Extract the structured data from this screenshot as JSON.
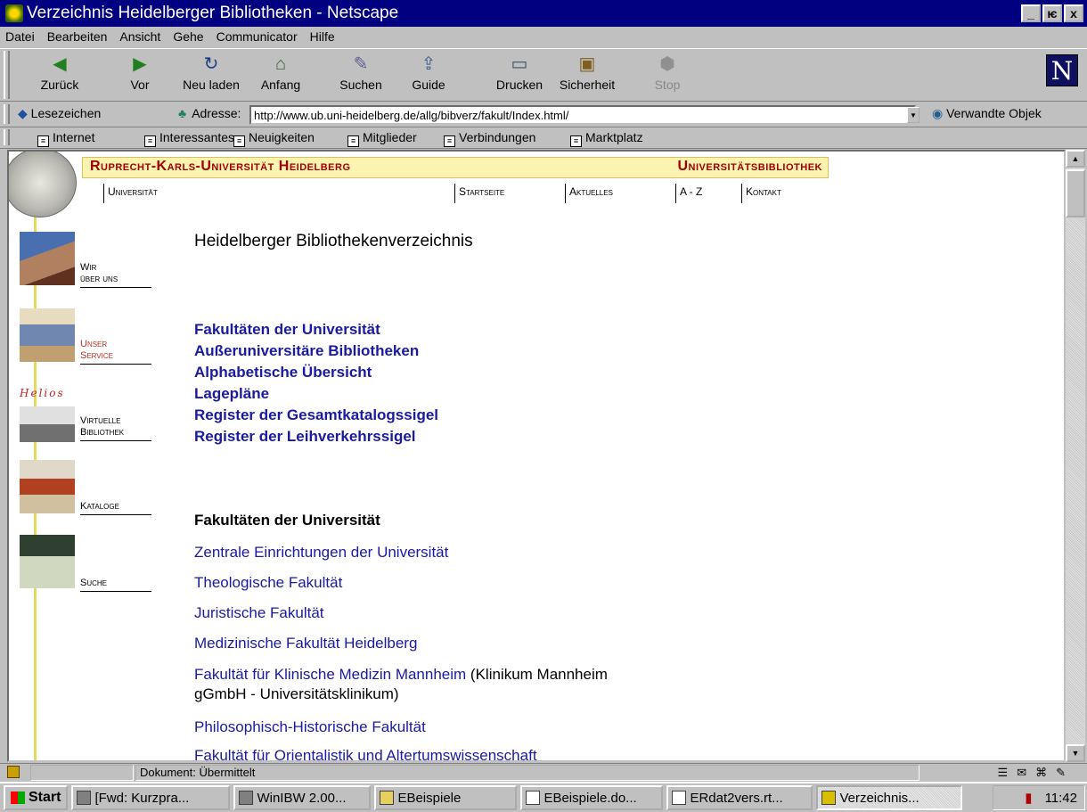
{
  "window": {
    "title": "Verzeichnis Heidelberger Bibliotheken - Netscape",
    "btn_min": "_",
    "btn_max": "ѥ",
    "btn_close": "x"
  },
  "menu": [
    "Datei",
    "Bearbeiten",
    "Ansicht",
    "Gehe",
    "Communicator",
    "Hilfe"
  ],
  "nav": {
    "back": "Zurück",
    "forward": "Vor",
    "reload": "Neu laden",
    "home": "Anfang",
    "search": "Suchen",
    "guide": "Guide",
    "print": "Drucken",
    "security": "Sicherheit",
    "stop": "Stop",
    "logo": "N"
  },
  "location": {
    "bookmarks": "Lesezeichen",
    "address_label": "Adresse:",
    "url": "http://www.ub.uni-heidelberg.de/allg/bibverz/fakult/Index.html/",
    "related": "Verwandte Objek"
  },
  "personal": [
    "Internet",
    "Interessantes",
    "Neuigkeiten",
    "Mitglieder",
    "Verbindungen",
    "Marktplatz"
  ],
  "page": {
    "university": "Ruprecht-Karls-Universität Heidelberg",
    "library": "Universitätsbibliothek",
    "topnav": {
      "uni": "Universität",
      "start": "Startseite",
      "news": "Aktuelles",
      "az": "A - Z",
      "contact": "Kontakt"
    },
    "heading": "Heidelberger Bibliothekenverzeichnis",
    "side": {
      "about_1": "Wir",
      "about_2": "über uns",
      "service_1": "Unser",
      "service_2": "Service",
      "helios": "Helios",
      "virtual_1": "Virtuelle",
      "virtual_2": "Bibliothek",
      "catalogs": "Kataloge",
      "search": "Suche"
    },
    "links": [
      "Fakultäten der Universität",
      "Außeruniversitäre Bibliotheken",
      "Alphabetische Übersicht",
      "Lagepläne",
      "Register der Gesamtkatalogssigel",
      "Register der Leihverkehrssigel"
    ],
    "section_title": "Fakultäten der Universität",
    "faculties": {
      "f1": "Zentrale Einrichtungen der Universität",
      "f2": "Theologische Fakultät",
      "f3": "Juristische Fakultät",
      "f4": "Medizinische Fakultät Heidelberg",
      "f5": "Fakultät für Klinische Medizin Mannheim",
      "f5_note1": " (Klinikum Mannheim",
      "f5_note2": "gGmbH - Universitätsklinikum)",
      "f6": "Philosophisch-Historische Fakultät",
      "f7": "Fakultät für Orientalistik und Altertumswissenschaft"
    }
  },
  "status": {
    "text": "Dokument: Übermittelt"
  },
  "taskbar": {
    "start": "Start",
    "tasks": [
      "[Fwd: Kurzpra...",
      "WinIBW 2.00...",
      "EBeispiele",
      "EBeispiele.do...",
      "ERdat2vers.rt...",
      "Verzeichnis..."
    ],
    "clock": "11:42"
  }
}
